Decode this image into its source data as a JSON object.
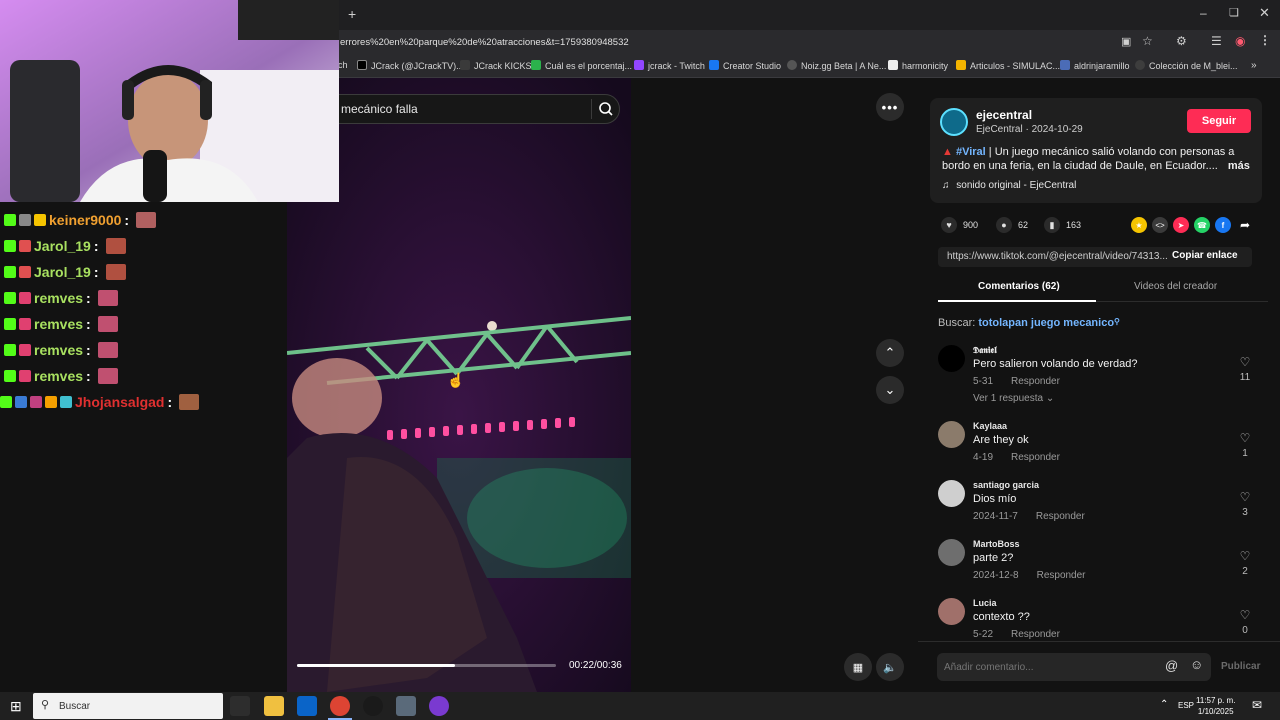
{
  "browser": {
    "url": "errores%20en%20parque%20de%20atracciones&t=1759380948532",
    "new_tab_symbol": "+",
    "bookmarks": [
      {
        "label": "ch",
        "color": "#1f1f21"
      },
      {
        "label": "JCrack (@JCrackTV)...",
        "color": "#000000"
      },
      {
        "label": "JCrack KICKS",
        "color": "#3a3a3a"
      },
      {
        "label": "Cuál es el porcentaj...",
        "color": "#2bb24c"
      },
      {
        "label": "jcrack - Twitch",
        "color": "#9146ff"
      },
      {
        "label": "Creator Studio",
        "color": "#1877f2"
      },
      {
        "label": "Noiz.gg Beta | A Ne...",
        "color": "#555555"
      },
      {
        "label": "harmonicity",
        "color": "#eeeeee"
      },
      {
        "label": "Articulos - SIMULAC...",
        "color": "#f4b400"
      },
      {
        "label": "aldrinjaramillo",
        "color": "#4b6cb7"
      },
      {
        "label": "Colección de M_blei...",
        "color": "#3d3d3d"
      }
    ]
  },
  "search": {
    "query": "mecánico falla"
  },
  "video": {
    "time": "00:22/00:36",
    "progress": 0.61
  },
  "creator": {
    "name": "ejecentral",
    "sub": "EjeCentral · 2024-10-29",
    "follow_label": "Seguir",
    "hashtag": "#Viral",
    "caption": " | Un juego mecánico salió volando con personas a bordo en una feria, en la ciudad de Daule, en Ecuador....",
    "more": "más",
    "sound": "sonido original - EjeCentral"
  },
  "stats": {
    "likes": "900",
    "comments": "62",
    "saves": "163"
  },
  "share_colors": [
    "#f5c400",
    "#3a3a3a",
    "#fe2c55",
    "#25d366",
    "#1877f2"
  ],
  "link": {
    "url": "https://www.tiktok.com/@ejecentral/video/74313...",
    "copy_label": "Copiar enlace"
  },
  "tabs": {
    "comments": "Comentarios (62)",
    "videos": "Videos del creador"
  },
  "suggestion": {
    "prefix": "Buscar:",
    "term": "totolapan juego mecanico"
  },
  "comments": [
    {
      "user": "𝕯𝖆𝖓𝖎𝖊𝖑",
      "text": "Pero salieron volando de verdad?",
      "date": "5-31",
      "reply": "Responder",
      "likes": "11",
      "replies": "Ver 1 respuesta",
      "avatar": "#000000"
    },
    {
      "user": "Kaylaaa",
      "text": "Are they ok",
      "date": "4-19",
      "reply": "Responder",
      "likes": "1",
      "avatar": "#8b7b6b"
    },
    {
      "user": "santiago garcia",
      "text": "Dios mío",
      "date": "2024-11-7",
      "reply": "Responder",
      "likes": "3",
      "avatar": "#cfcfcf"
    },
    {
      "user": "MartoBoss",
      "text": "parte 2?",
      "date": "2024-12-8",
      "reply": "Responder",
      "likes": "2",
      "avatar": "#6e6e6e"
    },
    {
      "user": "Lucia",
      "text": "contexto ??",
      "date": "5-22",
      "reply": "Responder",
      "likes": "0",
      "avatar": "#a0706a"
    }
  ],
  "comment_bar": {
    "placeholder": "Añadir comentario...",
    "publish": "Publicar"
  },
  "chat": [
    {
      "user": "keiner9000",
      "color": "#f0a030",
      "badges": [
        "#53fc18",
        "#888888",
        "#f5c400"
      ],
      "emote": "#b06060"
    },
    {
      "user": "Jarol_19",
      "color": "#a8e060",
      "badges": [
        "#53fc18",
        "#e05050"
      ],
      "emote": "#b05040"
    },
    {
      "user": "Jarol_19",
      "color": "#a8e060",
      "badges": [
        "#53fc18",
        "#e05050"
      ],
      "emote": "#b05040"
    },
    {
      "user": "remves",
      "color": "#a8e060",
      "badges": [
        "#53fc18",
        "#e04070"
      ],
      "emote": "#c05070"
    },
    {
      "user": "remves",
      "color": "#a8e060",
      "badges": [
        "#53fc18",
        "#e04070"
      ],
      "emote": "#c05070"
    },
    {
      "user": "remves",
      "color": "#a8e060",
      "badges": [
        "#53fc18",
        "#e04070"
      ],
      "emote": "#c05070"
    },
    {
      "user": "remves",
      "color": "#a8e060",
      "badges": [
        "#53fc18",
        "#e04070"
      ],
      "emote": "#c05070"
    },
    {
      "user": "Jhojansalgad",
      "color": "#e03030",
      "badges": [
        "#53fc18",
        "#3a7bd5",
        "#c04080",
        "#f5a000",
        "#40c0d0"
      ],
      "emote": "#a06040"
    }
  ],
  "chat_separator": ":",
  "taskbar": {
    "search_placeholder": "Buscar",
    "lang": "ESP",
    "time": "11:57 p. m.",
    "date": "1/10/2025",
    "apps": [
      "#2d2d2d",
      "#f0c040",
      "#0a64c8",
      "#dd4433",
      "#1a1a1a",
      "#5a6a7a",
      "#7a3ad0"
    ]
  }
}
